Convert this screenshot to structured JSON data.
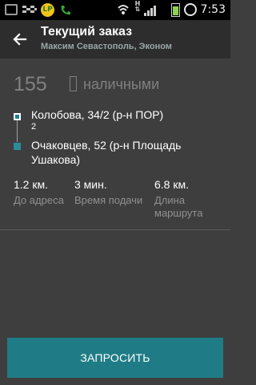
{
  "status_bar": {
    "time": "7:53",
    "network_label": "H",
    "lp_badge": "LP",
    "icons": [
      "notification-icon",
      "taxi-icon",
      "lp-app-icon",
      "phone-icon",
      "wifi-icon",
      "network-icon",
      "signal-icon",
      "battery-icon",
      "alarm-icon"
    ]
  },
  "header": {
    "title": "Текущий заказ",
    "subtitle": "Максим Севастополь, Эконом",
    "back_icon": "back-arrow-icon"
  },
  "order": {
    "price": "155",
    "payment": "наличными",
    "from": {
      "address": "Колобова, 34/2 (р-н ПОР)",
      "extra": "2"
    },
    "to": {
      "address": "Очаковцев, 52 (р-н Площадь Ушакова)"
    },
    "stats": [
      {
        "value": "1.2 км.",
        "label": "До адреса"
      },
      {
        "value": "3 мин.",
        "label": "Время подачи"
      },
      {
        "value": "6.8 км.",
        "label": "Длина маршрута"
      }
    ]
  },
  "actions": {
    "request_label": "ЗАПРОСИТЬ"
  },
  "colors": {
    "background": "#3e3e3e",
    "header": "#2d2d2d",
    "accent": "#1f7c86",
    "muted_text": "#808080"
  }
}
